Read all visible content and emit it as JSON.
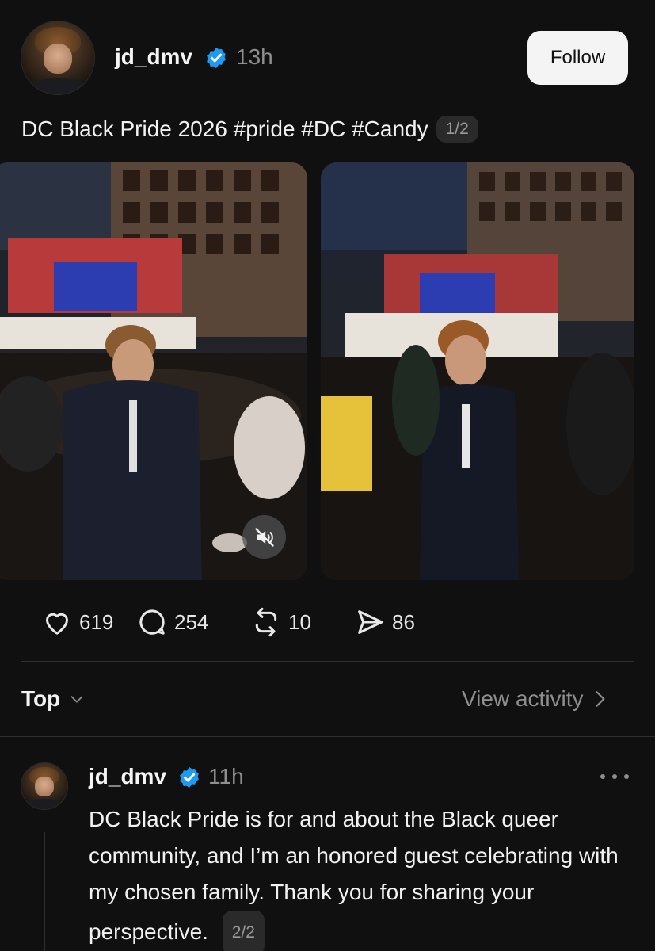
{
  "post": {
    "username": "jd_dmv",
    "time": "13h",
    "follow_label": "Follow",
    "caption": "DC Black Pride 2026 #pride #DC #Candy",
    "pager": "1/2",
    "media": [
      {
        "type": "video",
        "muted": true,
        "mute_icon": "speaker-muted-icon"
      },
      {
        "type": "image"
      }
    ],
    "actions": {
      "likes": "619",
      "replies": "254",
      "reposts": "10",
      "shares": "86"
    }
  },
  "replies_header": {
    "sort_label": "Top",
    "view_activity_label": "View activity"
  },
  "reply": {
    "username": "jd_dmv",
    "time": "11h",
    "text": "DC Black Pride is for and about the Black queer community, and I’m an honored guest celebrating with my chosen family. Thank you for sharing your perspective.",
    "pager": "2/2"
  },
  "colors": {
    "background": "#101010",
    "verified_badge": "#1d9bf0",
    "muted_text": "#8e8e8e",
    "follow_button_bg": "#f4f4f4"
  }
}
